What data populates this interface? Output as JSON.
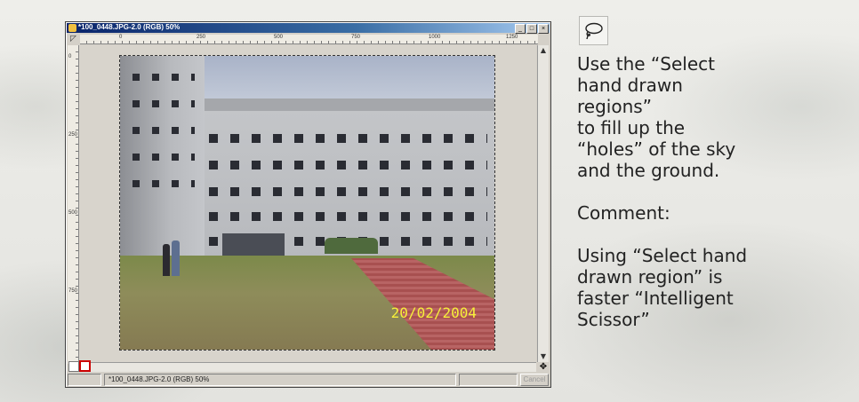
{
  "window": {
    "title": "*100_0448.JPG-2.0 (RGB) 50%",
    "controls": [
      "_",
      "□",
      "×"
    ]
  },
  "rulers": {
    "horizontal_ticks": [
      "0",
      "250",
      "500",
      "750",
      "1000",
      "1250"
    ],
    "vertical_ticks": [
      "0",
      "250",
      "500",
      "750"
    ]
  },
  "image": {
    "date_stamp": "20/02/2004"
  },
  "status": {
    "label": "*100_0448.JPG-2.0 (RGB) 50%",
    "cancel_label": "Cancel"
  },
  "tool": {
    "icon": "lasso-icon"
  },
  "instructions": {
    "lines": [
      "Use the “Select",
      "hand drawn",
      "regions”",
      "to fill up the",
      "“holes” of the sky",
      "and the ground."
    ],
    "comment_heading": "Comment:",
    "comment_lines": [
      "Using “Select hand",
      "drawn region” is",
      "faster “Intelligent",
      "Scissor”"
    ]
  },
  "colors": {
    "title_bar": "#0a246a",
    "date_stamp": "#f7f03a",
    "text": "#222222"
  }
}
